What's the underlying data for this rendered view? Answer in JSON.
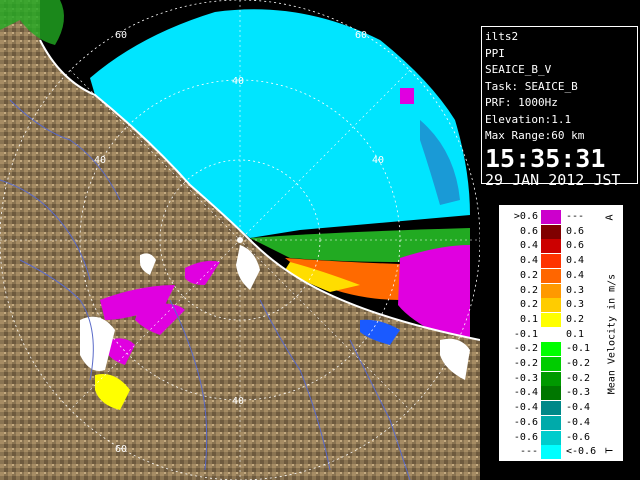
{
  "info": {
    "site": "ilts2",
    "mode": "PPI",
    "product": "SEAICE_B_V",
    "task": "Task: SEAICE_B",
    "prf": "PRF: 1000Hz",
    "elevation": "Elevation:1.1",
    "max_range": "Max Range:60 km",
    "time": "15:35:31",
    "date": "29 JAN 2012 JST"
  },
  "range_labels": {
    "top_60": "60",
    "top_60_right": "60",
    "mid_40": "40",
    "mid_40_right": "40",
    "left_40": "40",
    "bottom_40": "40",
    "bottom_60": "60"
  },
  "legend": {
    "title": "Mean Velocity in m/s",
    "corner_top": "A",
    "corner_bottom": "T",
    "rows": [
      {
        "left": ">0.6",
        "color": "#cc00cc",
        "right": "---"
      },
      {
        "left": "0.6",
        "color": "#800000",
        "right": "0.6"
      },
      {
        "left": "0.4",
        "color": "#cc0000",
        "right": "0.6"
      },
      {
        "left": "0.4",
        "color": "#ff3300",
        "right": "0.4"
      },
      {
        "left": "0.2",
        "color": "#ff6600",
        "right": "0.4"
      },
      {
        "left": "0.2",
        "color": "#ff9900",
        "right": "0.3"
      },
      {
        "left": "0.2",
        "color": "#ffcc00",
        "right": "0.3"
      },
      {
        "left": "0.1",
        "color": "#ffff00",
        "right": "0.2"
      },
      {
        "left": "-0.1",
        "color": "#ffffff",
        "right": "0.1"
      },
      {
        "left": "-0.2",
        "color": "#00ff00",
        "right": "-0.1"
      },
      {
        "left": "-0.2",
        "color": "#00cc00",
        "right": "-0.2"
      },
      {
        "left": "-0.3",
        "color": "#009900",
        "right": "-0.2"
      },
      {
        "left": "-0.4",
        "color": "#007700",
        "right": "-0.3"
      },
      {
        "left": "-0.4",
        "color": "#008888",
        "right": "-0.4"
      },
      {
        "left": "-0.6",
        "color": "#00aaaa",
        "right": "-0.4"
      },
      {
        "left": "-0.6",
        "color": "#00cccc",
        "right": "-0.6"
      },
      {
        "left": "---",
        "color": "#00ffff",
        "right": "<-0.6"
      }
    ]
  }
}
